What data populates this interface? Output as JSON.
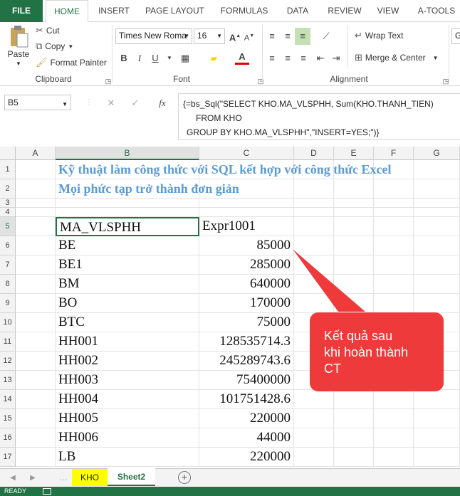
{
  "tabs": [
    "FILE",
    "HOME",
    "INSERT",
    "PAGE LAYOUT",
    "FORMULAS",
    "DATA",
    "REVIEW",
    "VIEW",
    "A-TOOLS"
  ],
  "clipboard": {
    "paste": "Paste",
    "cut": "Cut",
    "copy": "Copy",
    "format_painter": "Format Painter",
    "label": "Clipboard"
  },
  "font": {
    "name": "Times New Roma",
    "size": "16",
    "label": "Font",
    "bold": "B",
    "italic": "I",
    "underline": "U",
    "grow": "A",
    "shrink": "A",
    "color_a": "A"
  },
  "alignment": {
    "wrap": "Wrap Text",
    "merge": "Merge & Center",
    "label": "Alignment"
  },
  "number_box": "Ge",
  "name_box": "B5",
  "formula": {
    "fx": "fx",
    "line1": "{=bs_Sql(\"SELECT KHO.MA_VLSPHH, Sum(KHO.THANH_TIEN)",
    "line2": "FROM KHO",
    "line3": "GROUP BY KHO.MA_VLSPHH\",\"INSERT=YES;\")}"
  },
  "columns": [
    "A",
    "B",
    "C",
    "D",
    "E",
    "F",
    "G"
  ],
  "rows": [
    "1",
    "2",
    "3",
    "4",
    "5",
    "6",
    "7",
    "8",
    "9",
    "10",
    "11",
    "12",
    "13",
    "14",
    "15",
    "16",
    "17"
  ],
  "title1": "Kỹ thuật làm công thức với SQL kết hợp với công thức Excel",
  "title2": "Mọi phức tạp trở thành đơn giản",
  "header": {
    "b": "MA_VLSPHH",
    "c": "Expr1001"
  },
  "data": [
    {
      "b": "BE",
      "c": "85000"
    },
    {
      "b": "BE1",
      "c": "285000"
    },
    {
      "b": "BM",
      "c": "640000"
    },
    {
      "b": "BO",
      "c": "170000"
    },
    {
      "b": "BTC",
      "c": "75000"
    },
    {
      "b": "HH001",
      "c": "128535714.3"
    },
    {
      "b": "HH002",
      "c": "245289743.6"
    },
    {
      "b": "HH003",
      "c": "75400000"
    },
    {
      "b": "HH004",
      "c": "101751428.6"
    },
    {
      "b": "HH005",
      "c": "220000"
    },
    {
      "b": "HH006",
      "c": "44000"
    },
    {
      "b": "LB",
      "c": "220000"
    }
  ],
  "callout": {
    "line1": "Kết quả sau",
    "line2": "khi hoàn thành",
    "line3": "CT",
    "color": "#ee3a3a"
  },
  "sheets": [
    "KHO",
    "Sheet2"
  ],
  "status": "READY",
  "colors": {
    "accent": "#217346",
    "title": "#5b9bd5",
    "sheet_highlight": "#ffff00"
  }
}
